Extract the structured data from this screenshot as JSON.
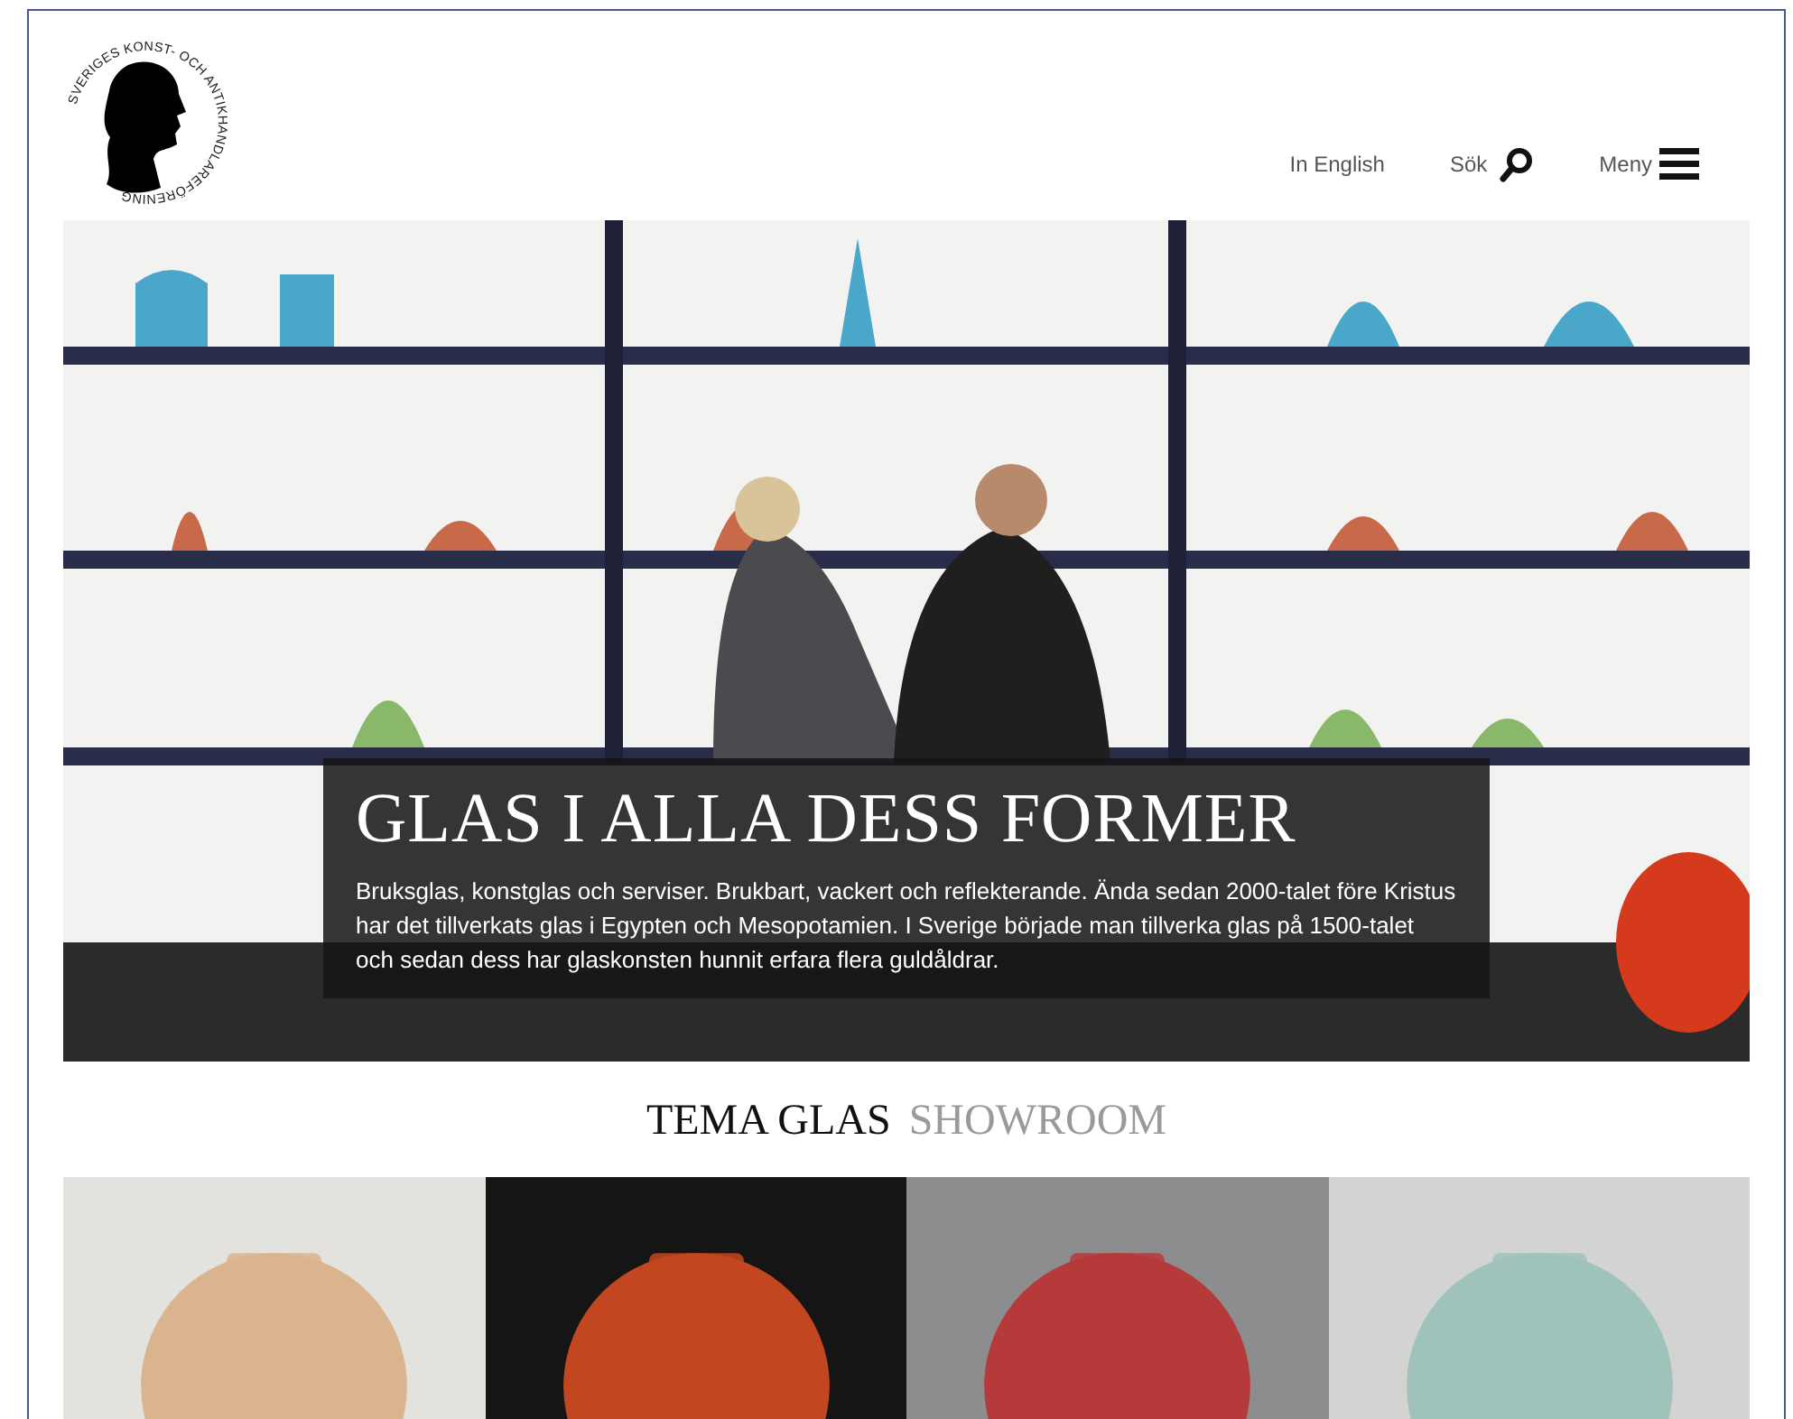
{
  "logo": {
    "ring_text": "SVERIGES KONST- OCH ANTIKHANDLAREFÖRENING"
  },
  "nav": [
    {
      "kind": "link",
      "label": "In English"
    },
    {
      "kind": "search",
      "label": "Sök"
    },
    {
      "kind": "menu",
      "label": "Meny"
    }
  ],
  "hero": {
    "kind": "picture",
    "title": "GLAS I ALLA DESS FORMER",
    "text": "Bruksglas, konstglas och serviser. Brukbart, vackert och reflekterande. Ända sedan 2000-talet före Kristus har det tillverkats glas i Egypten och Mesopotamien. I Sverige började man tillverka glas på 1500-talet och sedan dess har glaskonsten hunnit erfara flera guldåldrar."
  },
  "tabs": [
    {
      "label": "TEMA GLAS",
      "selected": true
    },
    {
      "label": "SHOWROOM",
      "selected": false
    }
  ]
}
